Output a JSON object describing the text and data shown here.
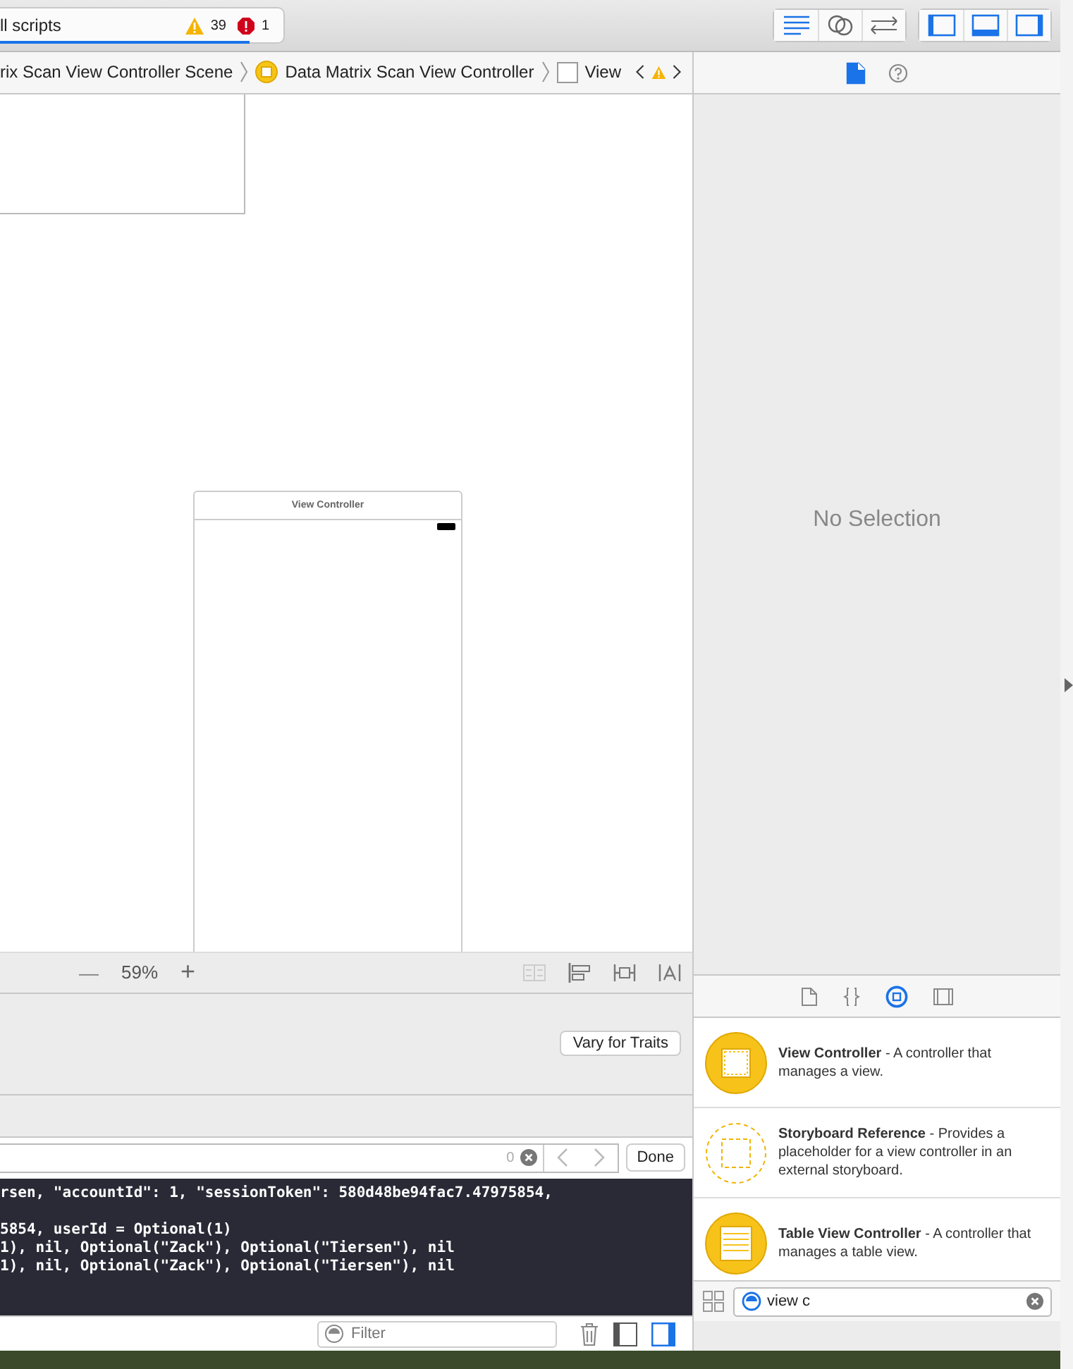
{
  "toolbar": {
    "scheme": "ll scripts",
    "warnings": "39",
    "errors": "1",
    "progress": {
      "level": 0.88
    },
    "editor_buttons": [
      {
        "kind": "standard",
        "selected": true
      },
      {
        "kind": "assistant",
        "selected": false
      },
      {
        "kind": "version",
        "selected": false
      }
    ],
    "panel_buttons": [
      {
        "kind": "navigator",
        "selected": true
      },
      {
        "kind": "debug",
        "selected": true
      },
      {
        "kind": "utilities",
        "selected": true
      }
    ]
  },
  "breadcrumb": [
    {
      "kind": "scene",
      "label": "rix Scan View Controller Scene"
    },
    {
      "kind": "controller",
      "label": "Data Matrix Scan View Controller"
    },
    {
      "kind": "view",
      "label": "View"
    }
  ],
  "canvas": {
    "scene_title": "View Controller"
  },
  "zoom": {
    "minus": "—",
    "level": "59%",
    "plus": "+"
  },
  "traits_button": "Vary for Traits",
  "find_bar": {
    "count": "0",
    "done": "Done"
  },
  "console": [
    "rsen, \"accountId\": 1, \"sessionToken\": 580d48be94fac7.47975854,",
    "5854, userId = Optional(1)",
    "1), nil, Optional(\"Zack\"), Optional(\"Tiersen\"), nil",
    "1), nil, Optional(\"Zack\"), Optional(\"Tiersen\"), nil"
  ],
  "console_filter": {
    "placeholder": "Filter"
  },
  "inspector": {
    "tabs": [
      {
        "kind": "file",
        "selected": true
      },
      {
        "kind": "help",
        "selected": false
      }
    ],
    "empty": "No Selection"
  },
  "library": {
    "tabs": [
      {
        "kind": "file",
        "selected": false
      },
      {
        "kind": "code",
        "selected": false
      },
      {
        "kind": "object",
        "selected": true
      },
      {
        "kind": "media",
        "selected": false
      }
    ],
    "items": [
      {
        "kind": "filled",
        "text": "**View Controller** - A controller that manages a view."
      },
      {
        "kind": "dashed",
        "text": "**Storyboard Reference** - Provides a placeholder for a view controller in an external storyboard."
      },
      {
        "kind": "table",
        "text": "**Table View Controller** - A controller that manages a table view."
      }
    ],
    "search": "view c"
  }
}
